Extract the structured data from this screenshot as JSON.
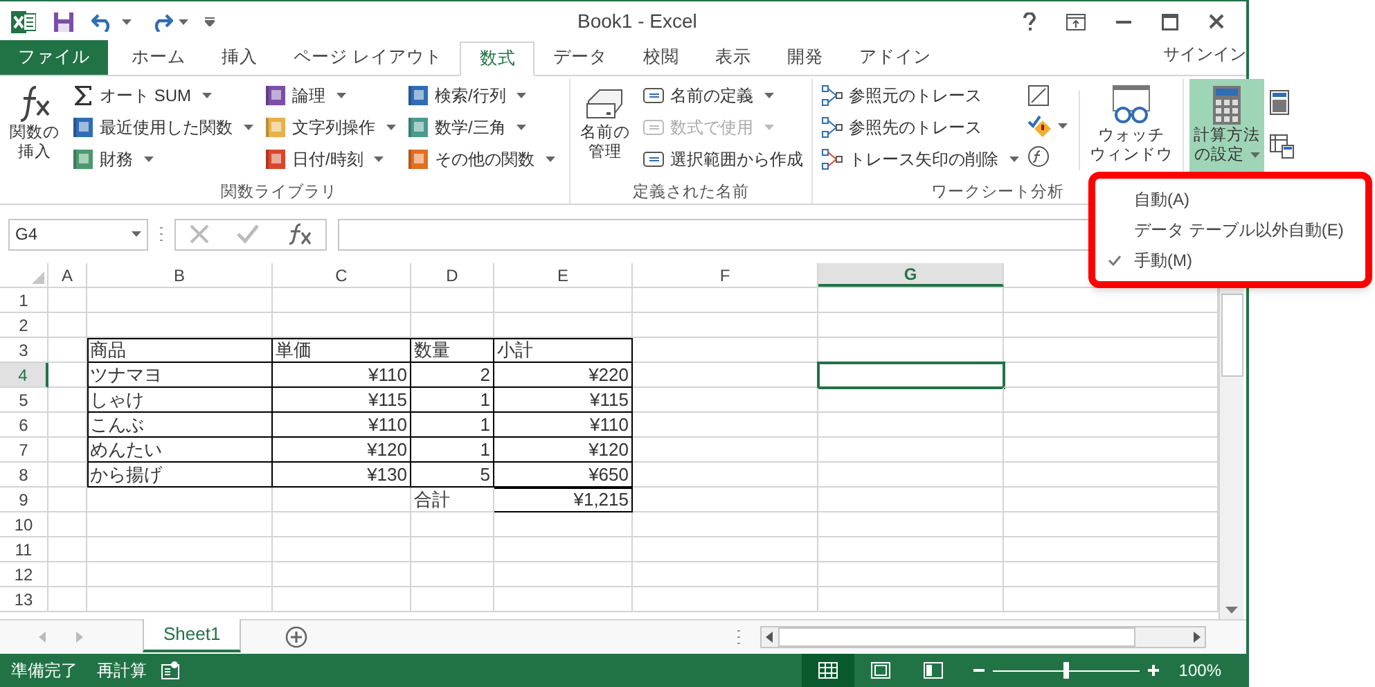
{
  "window": {
    "title": "Book1 - Excel"
  },
  "ribbon_tabs": [
    {
      "label": "ファイル",
      "kind": "file",
      "selected": false
    },
    {
      "label": "ホーム",
      "kind": "tab",
      "selected": false
    },
    {
      "label": "挿入",
      "kind": "tab",
      "selected": false
    },
    {
      "label": "ページ レイアウト",
      "kind": "tab",
      "selected": false
    },
    {
      "label": "数式",
      "kind": "tab",
      "selected": true
    },
    {
      "label": "データ",
      "kind": "tab",
      "selected": false
    },
    {
      "label": "校閲",
      "kind": "tab",
      "selected": false
    },
    {
      "label": "表示",
      "kind": "tab",
      "selected": false
    },
    {
      "label": "開発",
      "kind": "tab",
      "selected": false
    },
    {
      "label": "アドイン",
      "kind": "tab",
      "selected": false
    }
  ],
  "sign_in": "サインイン",
  "function_library": {
    "label": "関数ライブラリ",
    "insert_function": [
      "関数の",
      "挿入"
    ],
    "columns": [
      [
        {
          "label": "オート SUM",
          "kind": "sum",
          "color": "#333333"
        },
        {
          "label": "最近使用した関数",
          "kind": "book",
          "color": "#2f6db5"
        },
        {
          "label": "財務",
          "kind": "book",
          "color": "#4a9a6e"
        }
      ],
      [
        {
          "label": "論理",
          "kind": "book",
          "color": "#7b4fa8"
        },
        {
          "label": "文字列操作",
          "kind": "book",
          "color": "#e8b04a"
        },
        {
          "label": "日付/時刻",
          "kind": "book",
          "color": "#d9472b"
        }
      ],
      [
        {
          "label": "検索/行列",
          "kind": "book",
          "color": "#2f6db5"
        },
        {
          "label": "数学/三角",
          "kind": "book",
          "color": "#4a9a8e"
        },
        {
          "label": "その他の関数",
          "kind": "book",
          "color": "#e07020"
        }
      ]
    ]
  },
  "defined_names": {
    "label": "定義された名前",
    "name_manager": [
      "名前の",
      "管理"
    ],
    "items": [
      {
        "label": "名前の定義",
        "disabled": false,
        "dropdown": true
      },
      {
        "label": "数式で使用",
        "disabled": true,
        "dropdown": true
      },
      {
        "label": "選択範囲から作成",
        "disabled": false,
        "dropdown": false
      }
    ]
  },
  "formula_auditing": {
    "label": "ワークシート分析",
    "items": [
      {
        "label": "参照元のトレース",
        "dropdown": false
      },
      {
        "label": "参照先のトレース",
        "dropdown": false
      },
      {
        "label": "トレース矢印の削除",
        "dropdown": true
      }
    ],
    "watch_window": [
      "ウォッチ",
      "ウィンドウ"
    ]
  },
  "calculation": {
    "options_button": [
      "計算方法",
      "の設定"
    ],
    "pressed": true
  },
  "calculation_menu": [
    {
      "label": "自動(A)",
      "checked": false
    },
    {
      "label": "データ テーブル以外自動(E)",
      "checked": false
    },
    {
      "label": "手動(M)",
      "checked": true
    }
  ],
  "name_box": "G4",
  "columns": [
    {
      "label": "A",
      "selected": false
    },
    {
      "label": "B",
      "selected": false
    },
    {
      "label": "C",
      "selected": false
    },
    {
      "label": "D",
      "selected": false
    },
    {
      "label": "E",
      "selected": false
    },
    {
      "label": "F",
      "selected": false
    },
    {
      "label": "G",
      "selected": true
    }
  ],
  "rows": [
    {
      "label": "1",
      "selected": false
    },
    {
      "label": "2",
      "selected": false
    },
    {
      "label": "3",
      "selected": false
    },
    {
      "label": "4",
      "selected": true
    },
    {
      "label": "5",
      "selected": false
    },
    {
      "label": "6",
      "selected": false
    },
    {
      "label": "7",
      "selected": false
    },
    {
      "label": "8",
      "selected": false
    },
    {
      "label": "9",
      "selected": false
    },
    {
      "label": "10",
      "selected": false
    },
    {
      "label": "11",
      "selected": false
    },
    {
      "label": "12",
      "selected": false
    },
    {
      "label": "13",
      "selected": false
    }
  ],
  "table": {
    "header": [
      "商品",
      "単価",
      "数量",
      "小計"
    ],
    "rows": [
      [
        "ツナマヨ",
        "¥110",
        "2",
        "¥220"
      ],
      [
        "しゃけ",
        "¥115",
        "1",
        "¥115"
      ],
      [
        "こんぶ",
        "¥110",
        "1",
        "¥110"
      ],
      [
        "めんたい",
        "¥120",
        "1",
        "¥120"
      ],
      [
        "から揚げ",
        "¥130",
        "5",
        "¥650"
      ]
    ],
    "total": {
      "label": "合計",
      "value": "¥1,215"
    }
  },
  "sheet_tabs": [
    {
      "label": "Sheet1",
      "selected": true
    }
  ],
  "status_bar": {
    "ready": "準備完了",
    "recalc": "再計算",
    "views": [
      {
        "kind": "normal",
        "selected": true
      },
      {
        "kind": "page_layout",
        "selected": false
      },
      {
        "kind": "page_break",
        "selected": false
      }
    ],
    "zoom": {
      "level": 0.5,
      "reading": "100%"
    }
  }
}
